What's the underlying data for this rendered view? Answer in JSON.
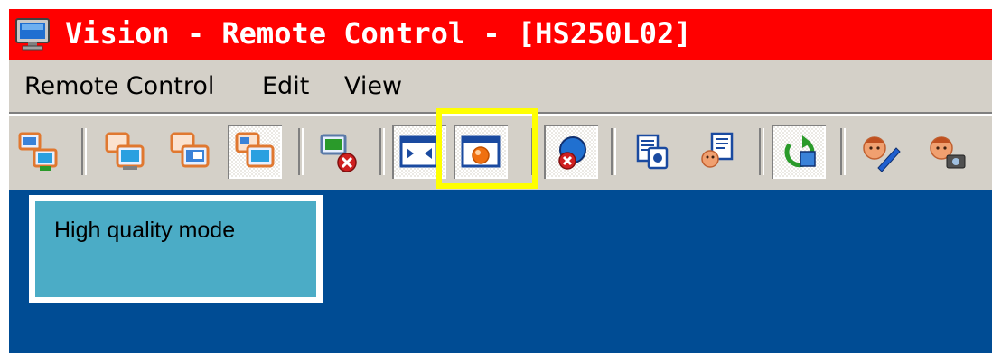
{
  "window": {
    "title": "Vision - Remote Control - [HS250L02]",
    "titlebar_color": "#ff0000",
    "app_icon": "monitor-icon"
  },
  "menubar": {
    "items": [
      "Remote Control",
      "Edit",
      "View"
    ]
  },
  "toolbar": {
    "buttons": [
      {
        "icon": "connect-monitors-icon",
        "pressed": false
      },
      {
        "icon": "view-monitor-icon",
        "pressed": false
      },
      {
        "icon": "share-monitor-icon",
        "pressed": false
      },
      {
        "icon": "control-monitor-icon",
        "pressed": true
      },
      {
        "icon": "disconnect-monitor-icon",
        "pressed": false
      },
      {
        "icon": "scale-to-window-icon",
        "pressed": true
      },
      {
        "icon": "high-quality-mode-icon",
        "pressed": true,
        "highlighted": true
      },
      {
        "icon": "blank-screen-icon",
        "pressed": true
      },
      {
        "icon": "clipboard-send-icon",
        "pressed": false
      },
      {
        "icon": "clipboard-receive-icon",
        "pressed": false
      },
      {
        "icon": "refresh-icon",
        "pressed": true
      },
      {
        "icon": "annotate-icon",
        "pressed": false
      },
      {
        "icon": "snapshot-icon",
        "pressed": false
      }
    ],
    "highlight_color": "#ffff00"
  },
  "tooltip": {
    "text": "High quality mode",
    "background": "#4bacc6"
  },
  "content": {
    "background": "#004c94"
  }
}
